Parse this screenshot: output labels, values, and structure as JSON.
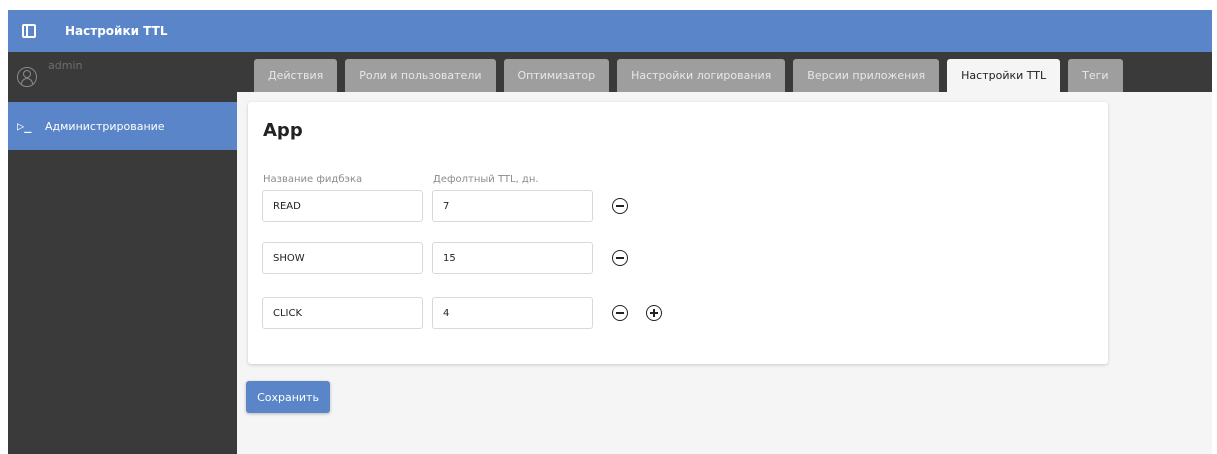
{
  "app": {
    "title": "Настройки TTL"
  },
  "user": {
    "name": "admin"
  },
  "sidebar": {
    "items": [
      {
        "label": "Администрирование",
        "icon": "terminal-icon",
        "active": true
      }
    ]
  },
  "tabs": [
    {
      "label": "Действия"
    },
    {
      "label": "Роли и пользователи"
    },
    {
      "label": "Оптимизатор"
    },
    {
      "label": "Настройки логирования"
    },
    {
      "label": "Версии приложения"
    },
    {
      "label": "Настройки TTL",
      "active": true
    },
    {
      "label": "Теги"
    }
  ],
  "card": {
    "title": "App",
    "col_name_label": "Название фидбэка",
    "col_ttl_label": "Дефолтный TTL, дн.",
    "rows": [
      {
        "name": "READ",
        "ttl": "7"
      },
      {
        "name": "SHOW",
        "ttl": "15"
      },
      {
        "name": "CLICK",
        "ttl": "4"
      }
    ]
  },
  "actions": {
    "save_label": "Сохранить"
  },
  "colors": {
    "accent": "#5a86c9",
    "sidebar_bg": "#3a3a3a",
    "tab_inactive": "#9e9e9e"
  }
}
